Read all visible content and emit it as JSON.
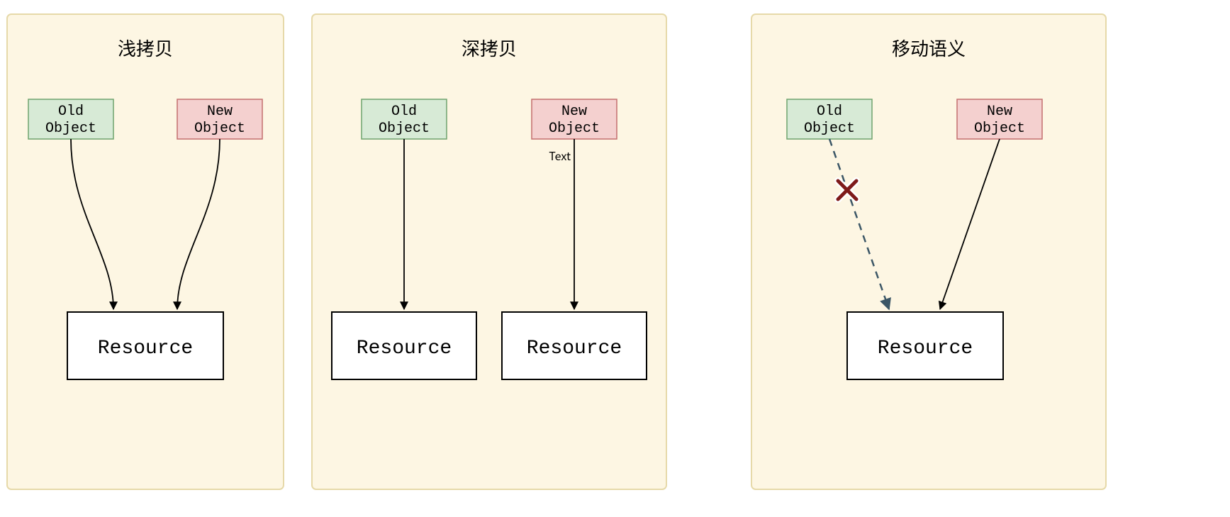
{
  "panels": [
    {
      "title": "浅拷贝",
      "old_label_line1": "Old",
      "old_label_line2": "Object",
      "new_label_line1": "New",
      "new_label_line2": "Object",
      "resource_label": "Resource",
      "extra_label": "",
      "variant": "shallow"
    },
    {
      "title": "深拷贝",
      "old_label_line1": "Old",
      "old_label_line2": "Object",
      "new_label_line1": "New",
      "new_label_line2": "Object",
      "resource_label": "Resource",
      "resource_label_2": "Resource",
      "extra_label": "Text",
      "variant": "deep"
    },
    {
      "title": "移动语义",
      "old_label_line1": "Old",
      "old_label_line2": "Object",
      "new_label_line1": "New",
      "new_label_line2": "Object",
      "resource_label": "Resource",
      "extra_label": "",
      "variant": "move"
    }
  ],
  "colors": {
    "panel_fill": "#FDF6E3",
    "panel_stroke": "#E6D9A9",
    "old_fill": "#D7EAD6",
    "old_stroke": "#6FA36E",
    "new_fill": "#F4D0CF",
    "new_stroke": "#C36F6F",
    "box_fill": "#FFFFFF",
    "box_stroke": "#000000",
    "dashed_stroke": "#3B5666",
    "x_stroke": "#7E1A19"
  }
}
